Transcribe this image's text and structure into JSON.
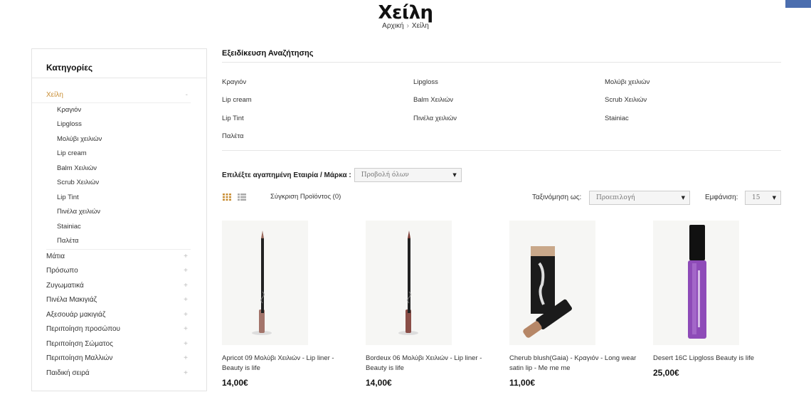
{
  "header": {
    "title": "Χείλη",
    "breadcrumb": {
      "home": "Αρχική",
      "separator": "›",
      "current": "Χείλη"
    }
  },
  "sidebar": {
    "title": "Κατηγορίες",
    "active_category": {
      "label": "Χείλη",
      "toggle": "-"
    },
    "subcategories": [
      "Κραγιόν",
      "Lipgloss",
      "Μολύβι χειλιών",
      "Lip cream",
      "Balm Χειλιών",
      "Scrub Χειλιών",
      "Lip Tint",
      "Πινέλα χειλιών",
      "Stainiac",
      "Παλέτα"
    ],
    "categories": [
      {
        "label": "Μάτια",
        "toggle": "+"
      },
      {
        "label": "Πρόσωπο",
        "toggle": "+"
      },
      {
        "label": "Ζυγωματικά",
        "toggle": "+"
      },
      {
        "label": "Πινέλα Μακιγιάζ",
        "toggle": "+"
      },
      {
        "label": "Αξεσουάρ μακιγιάζ",
        "toggle": "+"
      },
      {
        "label": "Περιποίηση προσώπου",
        "toggle": "+"
      },
      {
        "label": "Περιποίηση Σώματος",
        "toggle": "+"
      },
      {
        "label": "Περιποίηση Μαλλιών",
        "toggle": "+"
      },
      {
        "label": "Παιδική σειρά",
        "toggle": "+"
      }
    ]
  },
  "refine": {
    "title": "Εξειδίκευση Αναζήτησης",
    "links": [
      "Κραγιόν",
      "Lipgloss",
      "Μολύβι χειλιών",
      "Lip cream",
      "Balm Χειλιών",
      "Scrub Χειλιών",
      "Lip Tint",
      "Πινέλα χειλιών",
      "Stainiac",
      "Παλέτα"
    ]
  },
  "brand_filter": {
    "label": "Επιλέξτε αγαπημένη Εταιρία / Μάρκα :",
    "value": "Προβολή όλων"
  },
  "toolbar": {
    "compare_label": "Σύγκριση Προϊόντος (0)",
    "sort_label": "Ταξινόμηση ως:",
    "sort_value": "Προεπιλογή",
    "show_label": "Εμφάνιση:",
    "show_value": "15",
    "dropdown_arrow": "▼"
  },
  "products": [
    {
      "name": "Apricot 09 Μολύβι Χειλιών - Lip liner - Beauty is life",
      "price": "14,00€",
      "image_icon": "lip-liner-pencil-image"
    },
    {
      "name": "Bordeux 06 Μολύβι Χειλιών - Lip liner - Beauty is life",
      "price": "14,00€",
      "image_icon": "lip-liner-pencil-image"
    },
    {
      "name": "Cherub blush(Gaia) - Κραγιόν - Long wear satin lip - Me me me",
      "price": "11,00€",
      "image_icon": "lipstick-with-box-image"
    },
    {
      "name": "Desert 16C Lipgloss Beauty is life",
      "price": "25,00€",
      "image_icon": "lipgloss-tube-image"
    }
  ],
  "colors": {
    "accent": "#c98f36",
    "corner": "#4b6eaf"
  }
}
